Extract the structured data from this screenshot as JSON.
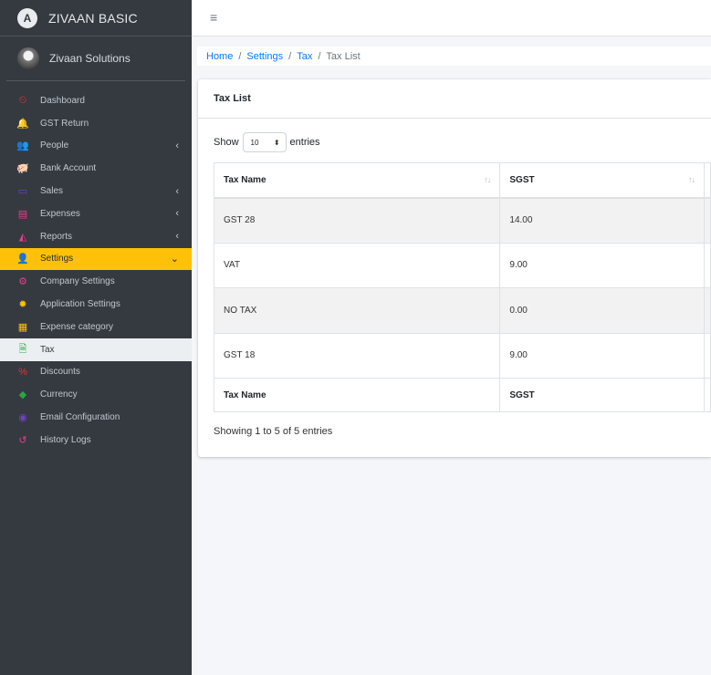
{
  "brand": {
    "logo_letter": "A",
    "name": "ZIVAAN BASIC"
  },
  "user": {
    "name": "Zivaan Solutions"
  },
  "topbar": {
    "menu_icon": "≡"
  },
  "sidebar": {
    "items": [
      {
        "label": "Dashboard",
        "icon": "dashboard-icon",
        "glyph": "⏲",
        "color": "#e3342f",
        "chevron": ""
      },
      {
        "label": "GST Return",
        "icon": "bell-icon",
        "glyph": "🔔",
        "color": "#ffc107",
        "chevron": ""
      },
      {
        "label": "People",
        "icon": "users-icon",
        "glyph": "👥",
        "color": "#28a745",
        "chevron": "‹"
      },
      {
        "label": "Bank Account",
        "icon": "piggy-bank-icon",
        "glyph": "🐖",
        "color": "#ffc107",
        "chevron": ""
      },
      {
        "label": "Sales",
        "icon": "store-icon",
        "glyph": "▭",
        "color": "#6f42c1",
        "chevron": "‹"
      },
      {
        "label": "Expenses",
        "icon": "money-check-icon",
        "glyph": "▤",
        "color": "#e83e8c",
        "chevron": "‹"
      },
      {
        "label": "Reports",
        "icon": "chart-area-icon",
        "glyph": "◭",
        "color": "#e83e8c",
        "chevron": "‹"
      },
      {
        "label": "Settings",
        "icon": "users-cog-icon",
        "glyph": "👤",
        "color": "#007bff",
        "chevron": "⌄",
        "state": "active"
      },
      {
        "label": "Company Settings",
        "icon": "cogs-icon",
        "glyph": "⚙",
        "color": "#e83e8c",
        "chevron": "",
        "state": "sub"
      },
      {
        "label": "Application Settings",
        "icon": "sun-gear-icon",
        "glyph": "✹",
        "color": "#ffc107",
        "chevron": "",
        "state": "sub"
      },
      {
        "label": "Expense category",
        "icon": "list-icon",
        "glyph": "▦",
        "color": "#ffc107",
        "chevron": "",
        "state": "sub"
      },
      {
        "label": "Tax",
        "icon": "file-invoice-icon",
        "glyph": "🗎",
        "color": "#28a745",
        "chevron": "",
        "state": "current"
      },
      {
        "label": "Discounts",
        "icon": "percent-icon",
        "glyph": "%",
        "color": "#e3342f",
        "chevron": "",
        "state": "sub"
      },
      {
        "label": "Currency",
        "icon": "ethereum-icon",
        "glyph": "◆",
        "color": "#28a745",
        "chevron": "",
        "state": "sub"
      },
      {
        "label": "Email Configuration",
        "icon": "at-icon",
        "glyph": "◉",
        "color": "#6f42c1",
        "chevron": "",
        "state": "sub"
      },
      {
        "label": "History Logs",
        "icon": "history-icon",
        "glyph": "↺",
        "color": "#e83e8c",
        "chevron": "",
        "state": "sub"
      }
    ]
  },
  "breadcrumb": {
    "home": "Home",
    "settings": "Settings",
    "tax": "Tax",
    "current": "Tax List",
    "separator": "/"
  },
  "card": {
    "title": "Tax List"
  },
  "length_control": {
    "prefix": "Show",
    "value": "10",
    "suffix": "entries"
  },
  "table": {
    "headers": {
      "name": "Tax Name",
      "sgst": "SGST"
    },
    "sort_icon": "↑↓",
    "rows": [
      {
        "name": "GST 28",
        "sgst": "14.00"
      },
      {
        "name": "VAT",
        "sgst": "9.00"
      },
      {
        "name": "NO TAX",
        "sgst": "0.00"
      },
      {
        "name": "GST 18",
        "sgst": "9.00"
      }
    ],
    "footers": {
      "name": "Tax Name",
      "sgst": "SGST"
    }
  },
  "info": "Showing 1 to 5 of 5 entries"
}
